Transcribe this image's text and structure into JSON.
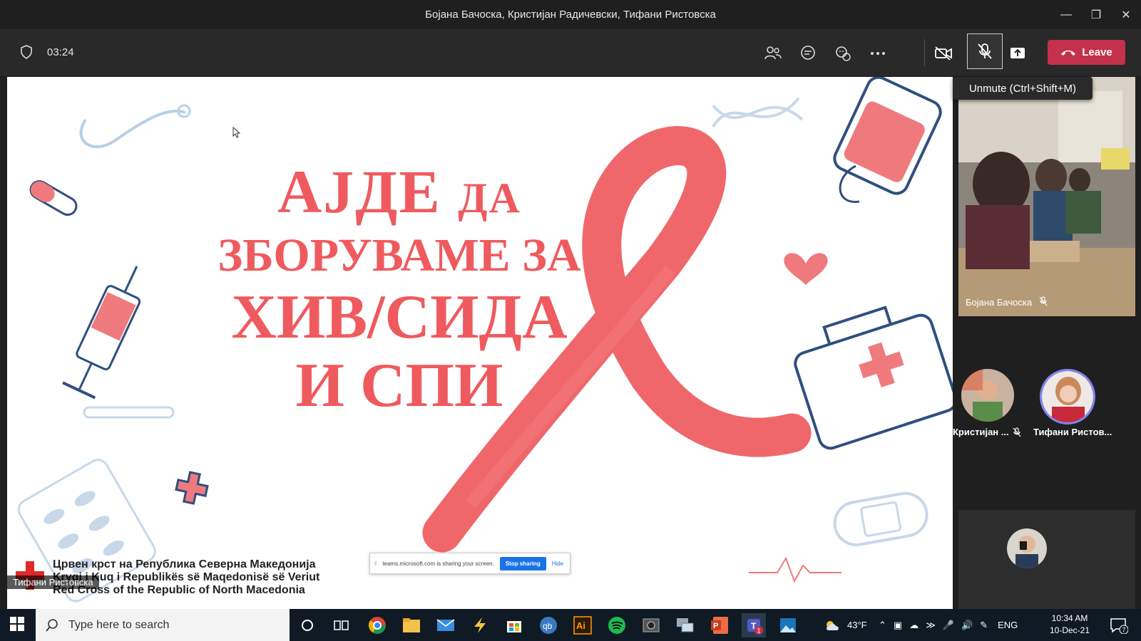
{
  "window": {
    "title": "Бојана Бачоска, Кристијан Радичевски, Тифани Ристовска"
  },
  "meeting": {
    "timer": "03:24",
    "leave_label": "Leave",
    "tooltip": "Unmute (Ctrl+Shift+M)"
  },
  "slide": {
    "line1_big": "АЈДЕ",
    "line1_small": "ДА",
    "line2": "ЗБОРУВАМЕ ЗА",
    "line3": "ХИВ/СИДА",
    "line4": "И СПИ",
    "org_line1": "Црвен крст на Република Северна Македонија",
    "org_line2": "Kryqi i Kuq i Republikës së Maqedonisë së Veriut",
    "org_line3": "Red Cross of the Republic of North Macedonia",
    "presenter": "Тифани Ристовска"
  },
  "share_bar": {
    "message": "teams.microsoft.com is sharing your screen.",
    "stop_label": "Stop sharing",
    "hide_label": "Hide"
  },
  "participants": {
    "video1_name": "Бојана Бачоска",
    "p2_name": "Кристијан ...",
    "p3_name": "Тифани Ристов..."
  },
  "taskbar": {
    "search_placeholder": "Type here to search",
    "weather": "43°F",
    "lang": "ENG",
    "time": "10:34 AM",
    "date": "10-Dec-21",
    "notif_count": "7",
    "teams_badge": "1"
  },
  "colors": {
    "accent_red": "#ef5a5e",
    "leave_red": "#c4314b",
    "meet_bar": "#292929"
  }
}
